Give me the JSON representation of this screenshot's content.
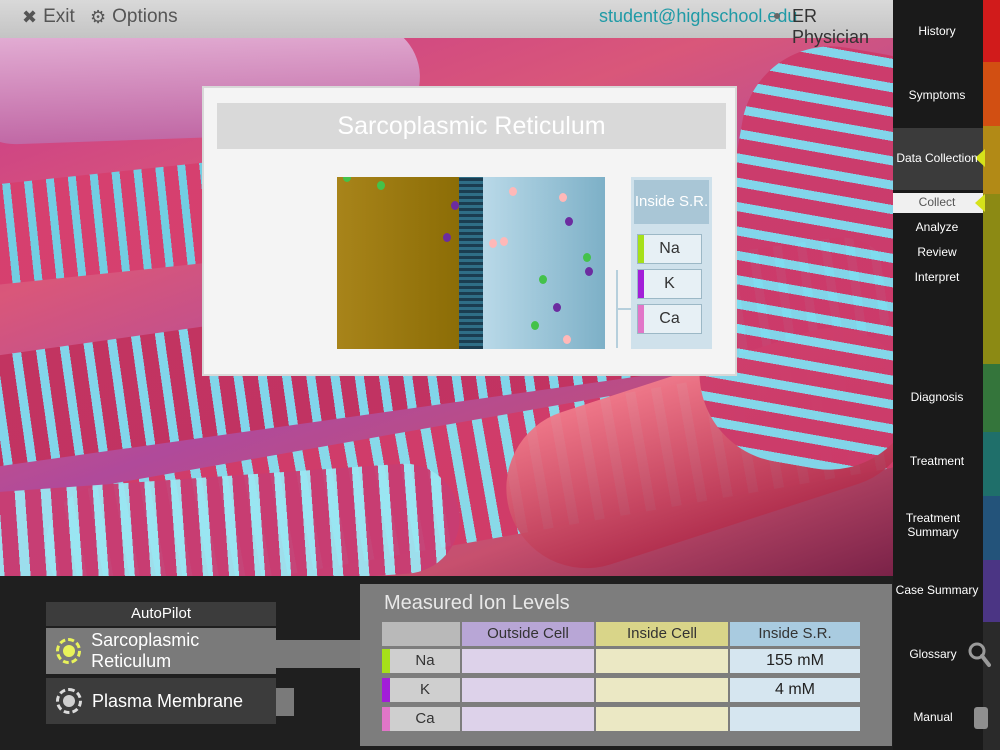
{
  "topbar": {
    "exit_label": "Exit",
    "options_label": "Options",
    "user_email": "student@highschool.edu",
    "role": "ER Physician"
  },
  "popup": {
    "title": "Sarcoplasmic Reticulum",
    "ion_panel_title": "Inside S.R.",
    "ion_buttons": [
      {
        "label": "Na",
        "color": "#a6e01a"
      },
      {
        "label": "K",
        "color": "#a21ed8"
      },
      {
        "label": "Ca",
        "color": "#e176c8"
      }
    ]
  },
  "sidebar": {
    "items": [
      {
        "label": "History"
      },
      {
        "label": "Symptoms"
      },
      {
        "label": "Data Collection"
      },
      {
        "label": "Diagnosis"
      },
      {
        "label": "Treatment"
      },
      {
        "label": "Treatment Summary"
      },
      {
        "label": "Case Summary"
      },
      {
        "label": "Glossary"
      },
      {
        "label": "Manual"
      }
    ],
    "subitems": [
      {
        "label": "Collect"
      },
      {
        "label": "Analyze"
      },
      {
        "label": "Review"
      },
      {
        "label": "Interpret"
      }
    ],
    "rail_colors": [
      "#d11b1b",
      "#e05a13",
      "#b56a16",
      "#9d8f12",
      "#7a8a18",
      "#3c7d36",
      "#1f6f63",
      "#1d5277",
      "#35407c",
      "#4b2f7a",
      "#3a3a3a"
    ],
    "accent_color": "#d6e21a"
  },
  "autopilot": {
    "title": "AutoPilot",
    "items": [
      {
        "label": "Sarcoplasmic Reticulum",
        "active": true
      },
      {
        "label": "Plasma Membrane",
        "active": false
      }
    ]
  },
  "measured": {
    "title": "Measured Ion Levels",
    "columns": [
      "Outside Cell",
      "Inside Cell",
      "Inside S.R."
    ],
    "column_colors": [
      "#b8a6d6",
      "#d9d589",
      "#a9cbe0"
    ],
    "rows": [
      {
        "label": "Na",
        "color": "#a6e01a",
        "values": [
          "",
          "",
          "155 mM"
        ]
      },
      {
        "label": "K",
        "color": "#a21ed8",
        "values": [
          "",
          "",
          "4 mM"
        ]
      },
      {
        "label": "Ca",
        "color": "#e176c8",
        "values": [
          "",
          "",
          ""
        ]
      }
    ]
  }
}
